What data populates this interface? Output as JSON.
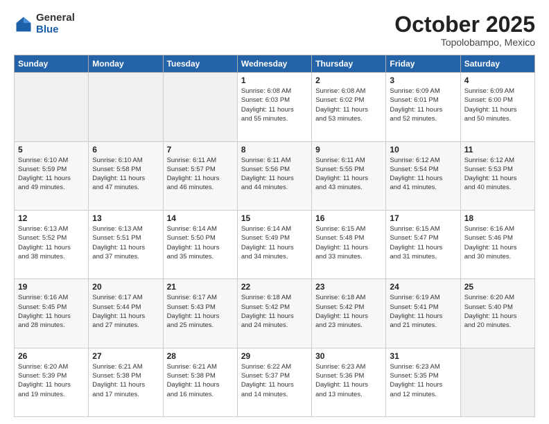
{
  "header": {
    "logo_general": "General",
    "logo_blue": "Blue",
    "month_title": "October 2025",
    "location": "Topolobampo, Mexico"
  },
  "weekdays": [
    "Sunday",
    "Monday",
    "Tuesday",
    "Wednesday",
    "Thursday",
    "Friday",
    "Saturday"
  ],
  "weeks": [
    [
      {
        "day": "",
        "info": ""
      },
      {
        "day": "",
        "info": ""
      },
      {
        "day": "",
        "info": ""
      },
      {
        "day": "1",
        "info": "Sunrise: 6:08 AM\nSunset: 6:03 PM\nDaylight: 11 hours\nand 55 minutes."
      },
      {
        "day": "2",
        "info": "Sunrise: 6:08 AM\nSunset: 6:02 PM\nDaylight: 11 hours\nand 53 minutes."
      },
      {
        "day": "3",
        "info": "Sunrise: 6:09 AM\nSunset: 6:01 PM\nDaylight: 11 hours\nand 52 minutes."
      },
      {
        "day": "4",
        "info": "Sunrise: 6:09 AM\nSunset: 6:00 PM\nDaylight: 11 hours\nand 50 minutes."
      }
    ],
    [
      {
        "day": "5",
        "info": "Sunrise: 6:10 AM\nSunset: 5:59 PM\nDaylight: 11 hours\nand 49 minutes."
      },
      {
        "day": "6",
        "info": "Sunrise: 6:10 AM\nSunset: 5:58 PM\nDaylight: 11 hours\nand 47 minutes."
      },
      {
        "day": "7",
        "info": "Sunrise: 6:11 AM\nSunset: 5:57 PM\nDaylight: 11 hours\nand 46 minutes."
      },
      {
        "day": "8",
        "info": "Sunrise: 6:11 AM\nSunset: 5:56 PM\nDaylight: 11 hours\nand 44 minutes."
      },
      {
        "day": "9",
        "info": "Sunrise: 6:11 AM\nSunset: 5:55 PM\nDaylight: 11 hours\nand 43 minutes."
      },
      {
        "day": "10",
        "info": "Sunrise: 6:12 AM\nSunset: 5:54 PM\nDaylight: 11 hours\nand 41 minutes."
      },
      {
        "day": "11",
        "info": "Sunrise: 6:12 AM\nSunset: 5:53 PM\nDaylight: 11 hours\nand 40 minutes."
      }
    ],
    [
      {
        "day": "12",
        "info": "Sunrise: 6:13 AM\nSunset: 5:52 PM\nDaylight: 11 hours\nand 38 minutes."
      },
      {
        "day": "13",
        "info": "Sunrise: 6:13 AM\nSunset: 5:51 PM\nDaylight: 11 hours\nand 37 minutes."
      },
      {
        "day": "14",
        "info": "Sunrise: 6:14 AM\nSunset: 5:50 PM\nDaylight: 11 hours\nand 35 minutes."
      },
      {
        "day": "15",
        "info": "Sunrise: 6:14 AM\nSunset: 5:49 PM\nDaylight: 11 hours\nand 34 minutes."
      },
      {
        "day": "16",
        "info": "Sunrise: 6:15 AM\nSunset: 5:48 PM\nDaylight: 11 hours\nand 33 minutes."
      },
      {
        "day": "17",
        "info": "Sunrise: 6:15 AM\nSunset: 5:47 PM\nDaylight: 11 hours\nand 31 minutes."
      },
      {
        "day": "18",
        "info": "Sunrise: 6:16 AM\nSunset: 5:46 PM\nDaylight: 11 hours\nand 30 minutes."
      }
    ],
    [
      {
        "day": "19",
        "info": "Sunrise: 6:16 AM\nSunset: 5:45 PM\nDaylight: 11 hours\nand 28 minutes."
      },
      {
        "day": "20",
        "info": "Sunrise: 6:17 AM\nSunset: 5:44 PM\nDaylight: 11 hours\nand 27 minutes."
      },
      {
        "day": "21",
        "info": "Sunrise: 6:17 AM\nSunset: 5:43 PM\nDaylight: 11 hours\nand 25 minutes."
      },
      {
        "day": "22",
        "info": "Sunrise: 6:18 AM\nSunset: 5:42 PM\nDaylight: 11 hours\nand 24 minutes."
      },
      {
        "day": "23",
        "info": "Sunrise: 6:18 AM\nSunset: 5:42 PM\nDaylight: 11 hours\nand 23 minutes."
      },
      {
        "day": "24",
        "info": "Sunrise: 6:19 AM\nSunset: 5:41 PM\nDaylight: 11 hours\nand 21 minutes."
      },
      {
        "day": "25",
        "info": "Sunrise: 6:20 AM\nSunset: 5:40 PM\nDaylight: 11 hours\nand 20 minutes."
      }
    ],
    [
      {
        "day": "26",
        "info": "Sunrise: 6:20 AM\nSunset: 5:39 PM\nDaylight: 11 hours\nand 19 minutes."
      },
      {
        "day": "27",
        "info": "Sunrise: 6:21 AM\nSunset: 5:38 PM\nDaylight: 11 hours\nand 17 minutes."
      },
      {
        "day": "28",
        "info": "Sunrise: 6:21 AM\nSunset: 5:38 PM\nDaylight: 11 hours\nand 16 minutes."
      },
      {
        "day": "29",
        "info": "Sunrise: 6:22 AM\nSunset: 5:37 PM\nDaylight: 11 hours\nand 14 minutes."
      },
      {
        "day": "30",
        "info": "Sunrise: 6:23 AM\nSunset: 5:36 PM\nDaylight: 11 hours\nand 13 minutes."
      },
      {
        "day": "31",
        "info": "Sunrise: 6:23 AM\nSunset: 5:35 PM\nDaylight: 11 hours\nand 12 minutes."
      },
      {
        "day": "",
        "info": ""
      }
    ]
  ]
}
